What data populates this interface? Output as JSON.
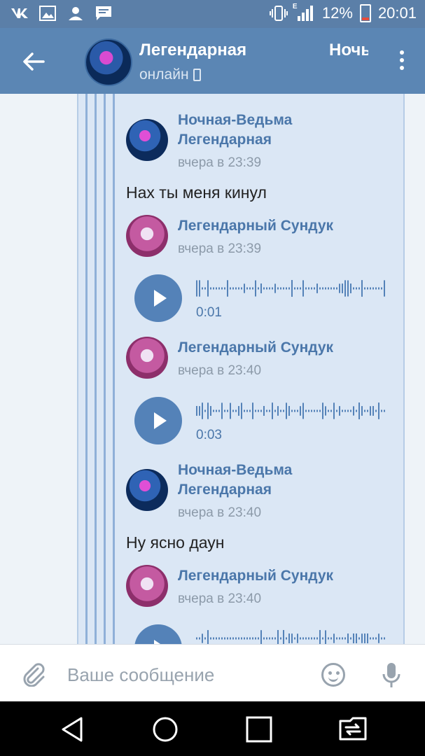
{
  "status_bar": {
    "battery_percent": "12%",
    "network_label": "E",
    "time": "20:01",
    "icons": [
      "vk-icon",
      "image-icon",
      "person-icon",
      "message-icon",
      "vibrate-icon",
      "signal-icon",
      "battery-icon"
    ]
  },
  "header": {
    "title_primary": "Легендарная",
    "title_secondary": "Ночь",
    "status": "онлайн"
  },
  "messages": [
    {
      "author": "Ночная-Ведьма Легендарная",
      "author_line1": "Ночная-Ведьма",
      "author_line2": "Легендарная",
      "time": "вчера в 23:39",
      "text": "Нах ты меня кинул"
    },
    {
      "author": "Легендарный Сундук",
      "time": "вчера в 23:39",
      "voice_duration": "0:01"
    },
    {
      "author": "Легендарный Сундук",
      "time": "вчера в 23:40",
      "voice_duration": "0:03"
    },
    {
      "author": "Ночная-Ведьма Легендарная",
      "author_line1": "Ночная-Ведьма",
      "author_line2": "Легендарная",
      "time": "вчера в 23:40",
      "text": "Ну ясно даун"
    },
    {
      "author": "Легендарный Сундук",
      "time": "вчера в 23:40"
    }
  ],
  "composer": {
    "placeholder": "Ваше сообщение"
  },
  "colors": {
    "header": "#5b86b4",
    "status_bar": "#5b7fa8",
    "accent": "#4b77aa",
    "forwarded_bg": "#dbe7f5",
    "play_button": "#5482b8"
  }
}
